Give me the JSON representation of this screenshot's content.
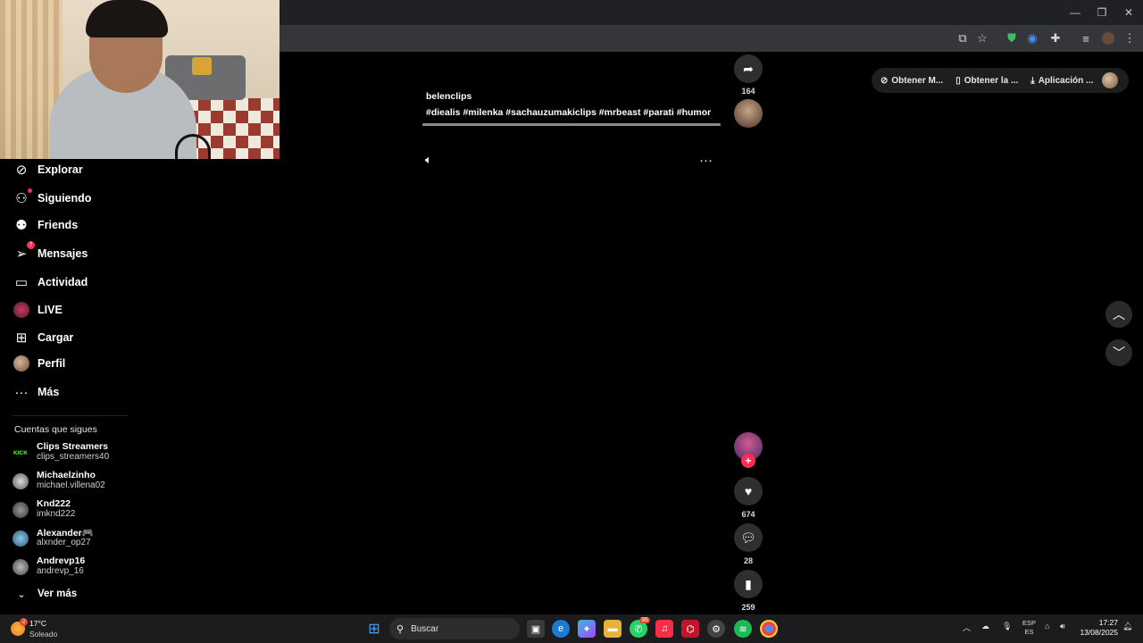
{
  "window": {
    "minimize": "—",
    "restore": "❐",
    "close": "✕"
  },
  "sidebar": {
    "items": [
      {
        "label": "Explorar"
      },
      {
        "label": "Siguiendo"
      },
      {
        "label": "Friends"
      },
      {
        "label": "Mensajes",
        "badge": "7"
      },
      {
        "label": "Actividad"
      },
      {
        "label": "LIVE"
      },
      {
        "label": "Cargar"
      },
      {
        "label": "Perfil"
      },
      {
        "label": "Más"
      }
    ],
    "following_title": "Cuentas que sigues",
    "accounts": [
      {
        "name": "Clips Streamers",
        "user": "clips_streamers40",
        "avatar_text": "KICK"
      },
      {
        "name": "Michaelzinho",
        "user": "michael.villena02"
      },
      {
        "name": "Knd222",
        "user": "imknd222"
      },
      {
        "name": "Alexander🎮",
        "user": "alxnder_op27"
      },
      {
        "name": "Andrevp16",
        "user": "andrevp_16"
      }
    ],
    "see_more": "Ver más"
  },
  "video": {
    "username": "belenclips",
    "hashtags": "#diealis #milenka #sachauzumakiclips #mrbeast #parati #humor",
    "progress": 1.0
  },
  "actions_top": {
    "share_count": "164"
  },
  "actions_bottom": {
    "like_count": "674",
    "comment_count": "28",
    "save_count": "259"
  },
  "top_pill": {
    "item1": "Obtener M...",
    "item2": "Obtener la ...",
    "item3": "Aplicación ..."
  },
  "taskbar": {
    "temp": "17°C",
    "condition": "Soleado",
    "weather_badge": "2",
    "search": "Buscar",
    "whatsapp_badge": "36",
    "lang1": "ESP",
    "lang2": "ES",
    "time": "17:27",
    "date": "13/08/2025"
  },
  "colors": {
    "accent": "#fe2c55",
    "background": "#000000",
    "chrome": "#35363a"
  }
}
